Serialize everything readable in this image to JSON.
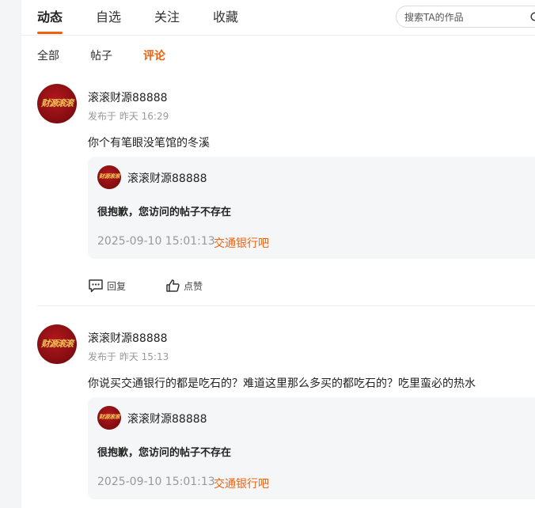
{
  "tabs": [
    {
      "label": "动态",
      "active": true
    },
    {
      "label": "自选",
      "active": false
    },
    {
      "label": "关注",
      "active": false
    },
    {
      "label": "收藏",
      "active": false
    }
  ],
  "search": {
    "placeholder": "搜索TA的作品",
    "icon": "search-icon"
  },
  "subtabs": [
    {
      "label": "全部",
      "active": false
    },
    {
      "label": "帖子",
      "active": false
    },
    {
      "label": "评论",
      "active": true
    }
  ],
  "accent_color": "#f2600c",
  "items": [
    {
      "avatar_text": "财源滚滚",
      "author": "滚滚财源88888",
      "time": "发布于 昨天 16:29",
      "content": "你个有笔眼没笔馆的冬溪",
      "quote": {
        "author": "滚滚财源88888",
        "message": "很抱歉，您访问的帖子不存在",
        "time": "2025-09-10 15:01:13",
        "bar": "交通银行吧"
      },
      "actions": {
        "reply": "回复",
        "like": "点赞"
      }
    },
    {
      "avatar_text": "财源滚滚",
      "author": "滚滚财源88888",
      "time": "发布于 昨天 15:13",
      "content": "你说买交通银行的都是吃石的？难道这里那么多买的都吃石的？吃里蛮必的热水",
      "quote": {
        "author": "滚滚财源88888",
        "message": "很抱歉，您访问的帖子不存在",
        "time": "2025-09-10 15:01:13",
        "bar": "交通银行吧"
      }
    }
  ]
}
